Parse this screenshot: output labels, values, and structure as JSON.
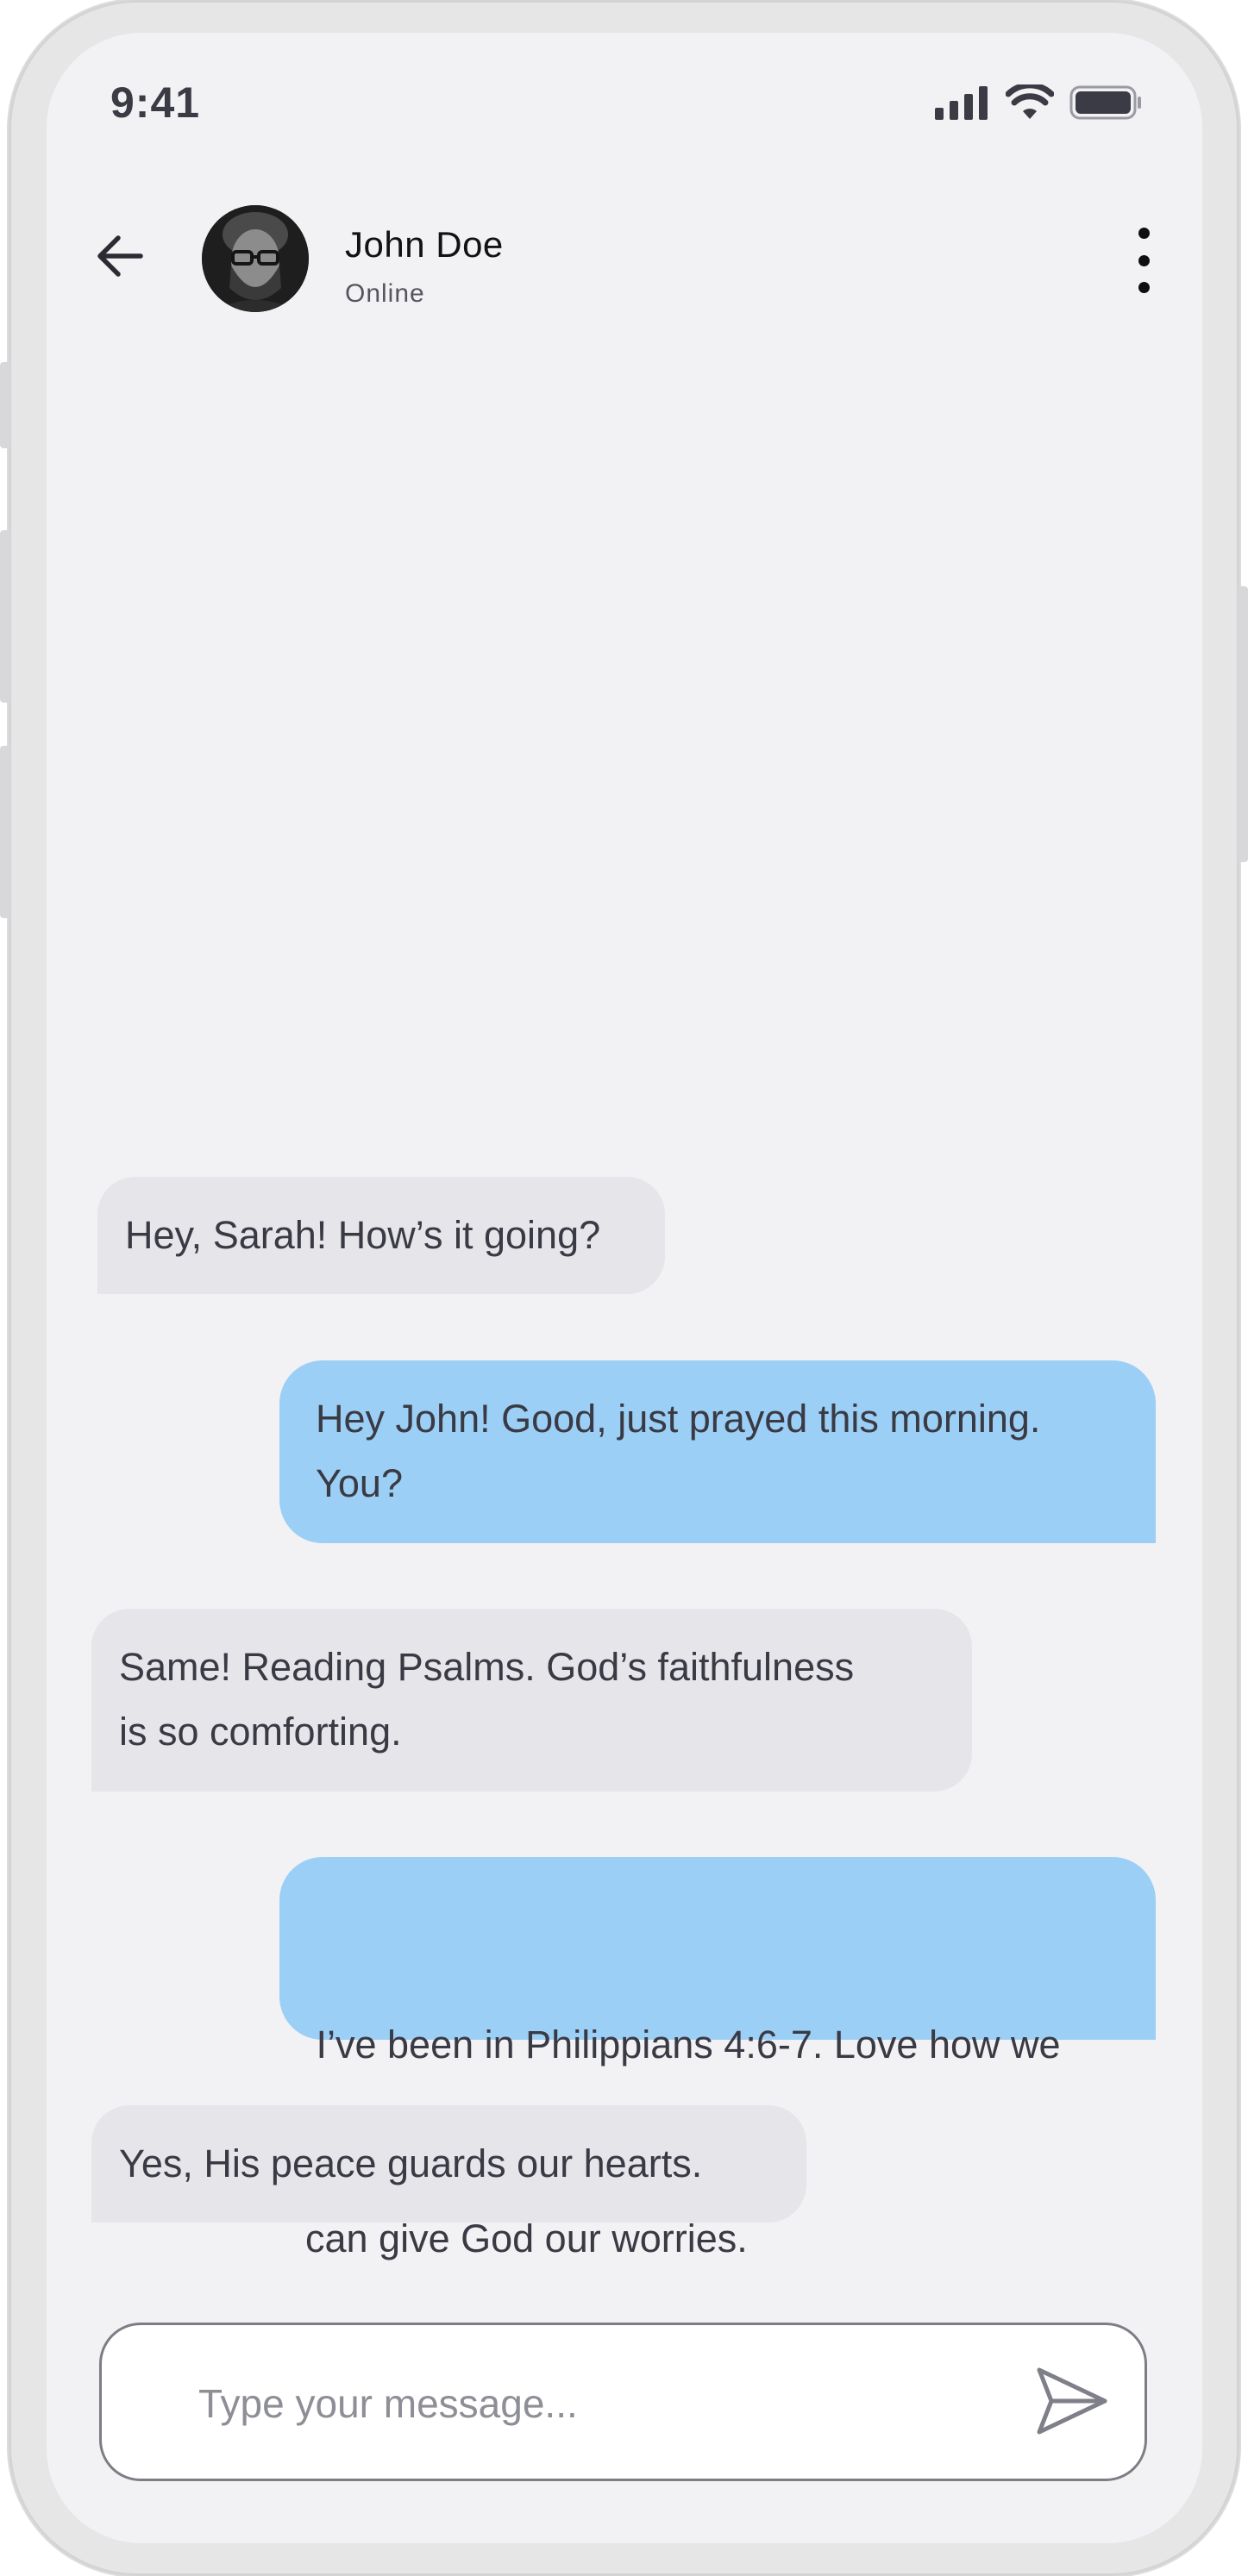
{
  "status_bar": {
    "time": "9:41",
    "icons": [
      "cellular-signal-icon",
      "wifi-icon",
      "battery-icon"
    ]
  },
  "header": {
    "back_icon": "arrow-left-icon",
    "contact_name": "John Doe",
    "contact_status": "Online",
    "menu_icon": "more-vertical-icon"
  },
  "messages": [
    {
      "direction": "incoming",
      "text": "Hey, Sarah! How’s it going?"
    },
    {
      "direction": "outgoing",
      "lines": [
        "Hey John! Good, just prayed this morning.",
        "You?"
      ]
    },
    {
      "direction": "incoming",
      "lines": [
        "Same! Reading Psalms. God’s faithfulness",
        "is so comforting."
      ]
    },
    {
      "direction": "outgoing",
      "lines": [
        " I’ve been in Philippians 4:6-7. Love how we",
        "can give God our worries."
      ]
    },
    {
      "direction": "incoming",
      "text": "Yes, His peace guards our hearts."
    }
  ],
  "composer": {
    "placeholder": "Type your message...",
    "value": "",
    "send_icon": "send-icon"
  },
  "colors": {
    "screen_background": "#f2f2f4",
    "incoming_bubble": "#e6e6ea",
    "outgoing_bubble": "#9bcff5",
    "text": "#3a3a44"
  }
}
